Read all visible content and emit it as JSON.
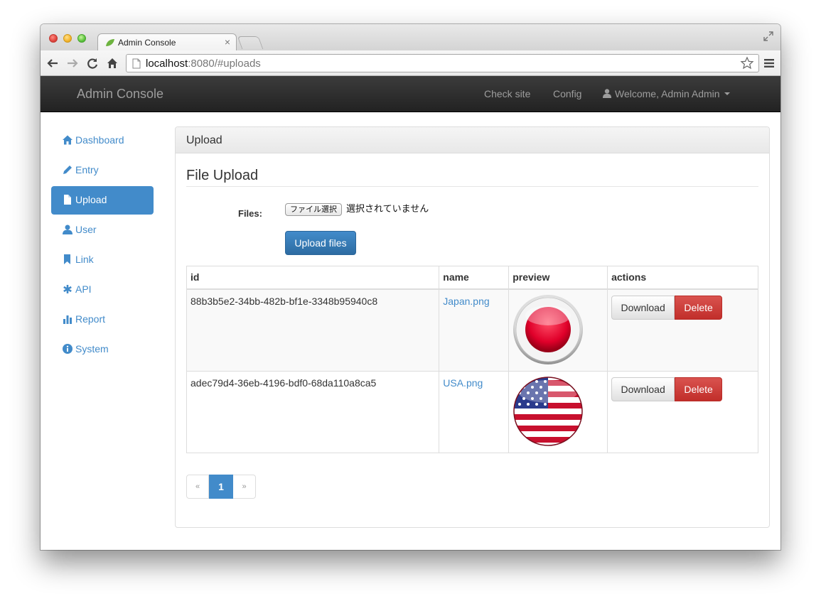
{
  "browser": {
    "tab_title": "Admin Console",
    "tab_close": "×",
    "url_host": "localhost",
    "url_rest": ":8080/#uploads"
  },
  "navbar": {
    "brand": "Admin Console",
    "links": [
      "Check site",
      "Config"
    ],
    "user": "Welcome, Admin Admin"
  },
  "sidebar": {
    "items": [
      {
        "label": "Dashboard",
        "icon": "home-icon"
      },
      {
        "label": "Entry",
        "icon": "pencil-icon"
      },
      {
        "label": "Upload",
        "icon": "file-icon",
        "active": true
      },
      {
        "label": "User",
        "icon": "user-icon"
      },
      {
        "label": "Link",
        "icon": "bookmark-icon"
      },
      {
        "label": "API",
        "icon": "asterisk-icon"
      },
      {
        "label": "Report",
        "icon": "stats-icon"
      },
      {
        "label": "System",
        "icon": "info-icon"
      }
    ]
  },
  "panel": {
    "heading": "Upload",
    "section_title": "File Upload",
    "files_label": "Files:",
    "file_button": "ファイル選択",
    "file_status": "選択されていません",
    "upload_button": "Upload files"
  },
  "table": {
    "headers": [
      "id",
      "name",
      "preview",
      "actions"
    ],
    "rows": [
      {
        "id": "88b3b5e2-34bb-482b-bf1e-3348b95940c8",
        "name": "Japan.png",
        "preview": "japan-flag-icon",
        "download": "Download",
        "delete": "Delete"
      },
      {
        "id": "adec79d4-36eb-4196-bdf0-68da110a8ca5",
        "name": "USA.png",
        "preview": "usa-flag-icon",
        "download": "Download",
        "delete": "Delete"
      }
    ]
  },
  "pagination": {
    "prev": "«",
    "current": "1",
    "next": "»"
  },
  "colors": {
    "primary": "#428bca",
    "danger": "#d9534f",
    "navbar": "#222222"
  }
}
